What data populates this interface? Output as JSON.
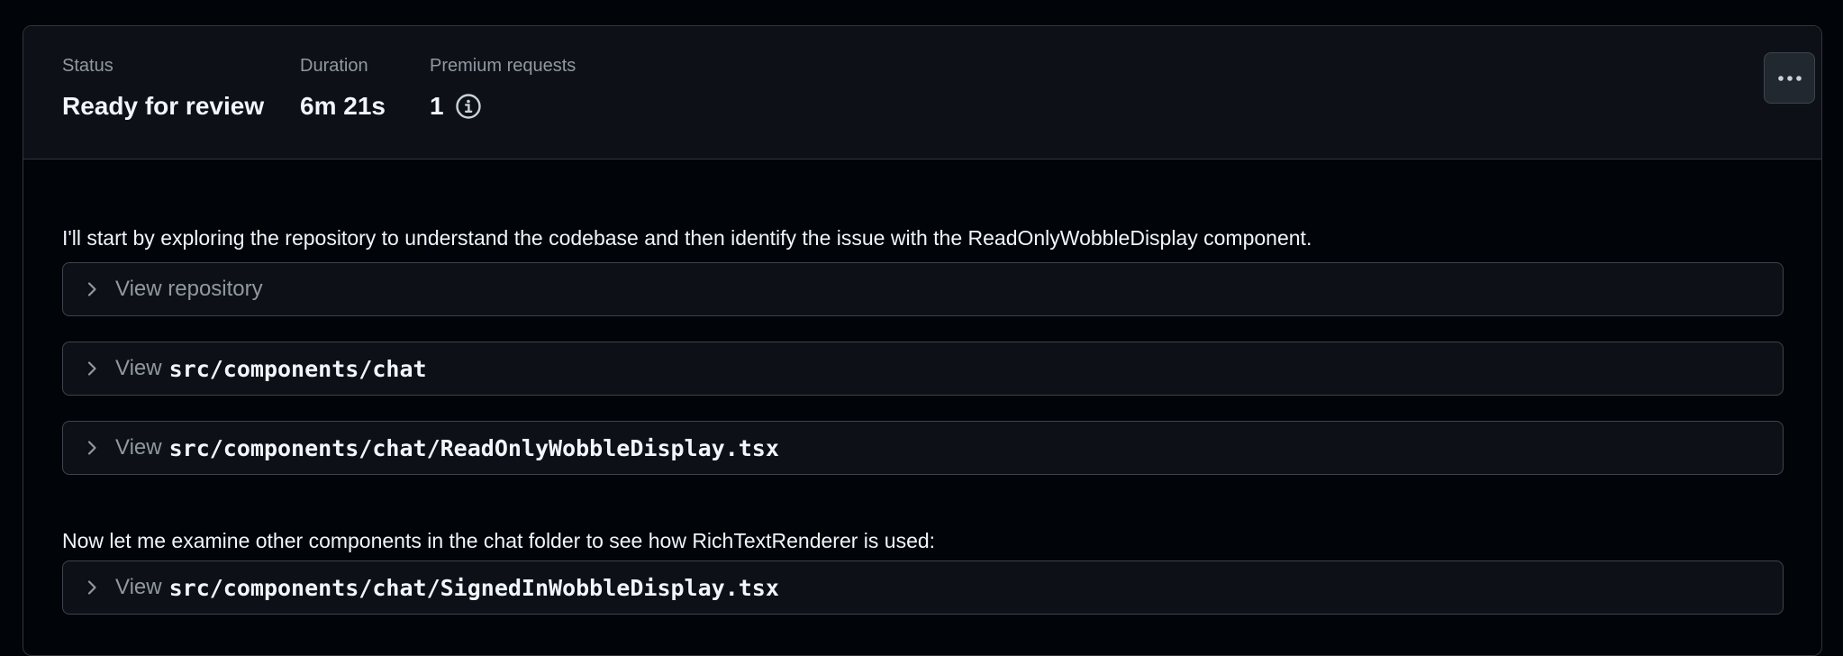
{
  "header": {
    "status": {
      "label": "Status",
      "value": "Ready for review"
    },
    "duration": {
      "label": "Duration",
      "value": "6m 21s"
    },
    "premium": {
      "label": "Premium requests",
      "value": "1"
    },
    "more_icon": "kebab-horizontal-icon",
    "info_icon": "info-icon"
  },
  "log": {
    "message_1": "I'll start by exploring the repository to understand the codebase and then identify the issue with the ReadOnlyWobbleDisplay component.",
    "step_1": {
      "verb": "View repository",
      "path": ""
    },
    "step_2": {
      "verb": "View",
      "path": "src/components/chat"
    },
    "step_3": {
      "verb": "View",
      "path": "src/components/chat/ReadOnlyWobbleDisplay.tsx"
    },
    "message_2": "Now let me examine other components in the chat folder to see how RichTextRenderer is used:",
    "step_4": {
      "verb": "View",
      "path": "src/components/chat/SignedInWobbleDisplay.tsx"
    }
  },
  "colors": {
    "background": "#010409",
    "surface": "#0d1117",
    "border": "#3d444d",
    "text_primary": "#f0f6fc",
    "text_muted": "#9198a1"
  }
}
